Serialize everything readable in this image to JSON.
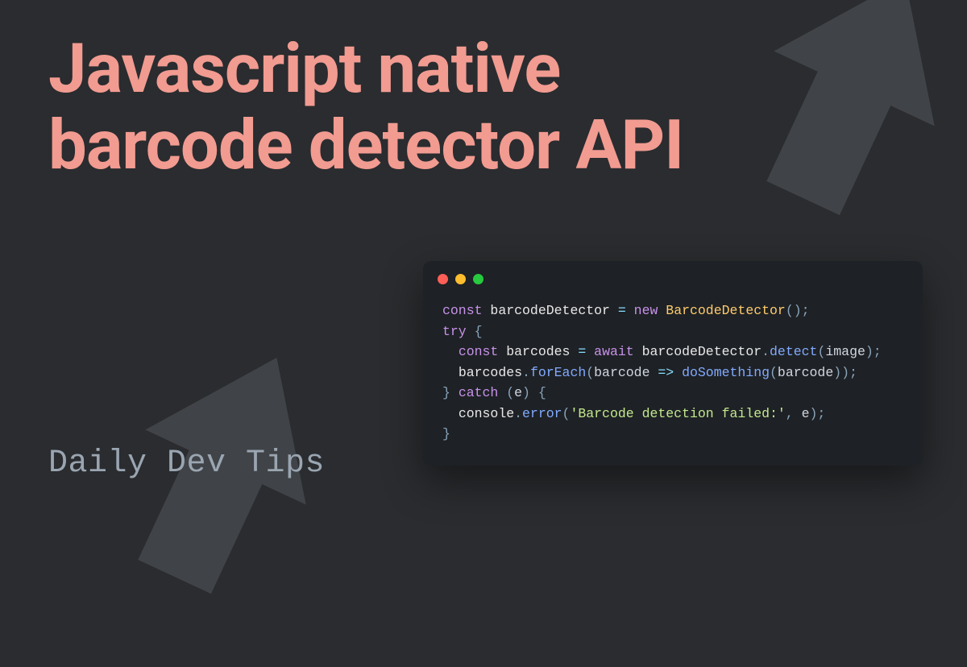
{
  "title_line1": "Javascript native",
  "title_line2": "barcode detector API",
  "footer": "Daily Dev Tips",
  "colors": {
    "background": "#2a2c2f",
    "title": "#f29b91",
    "footer": "#9aa5b1",
    "code_bg": "#1e2125",
    "arrow": "#404347"
  },
  "code": {
    "tokens": {
      "const": "const",
      "barcodeDetector": "barcodeDetector",
      "eq": "=",
      "new": "new",
      "BarcodeDetector": "BarcodeDetector",
      "lparen": "(",
      "rparen": ")",
      "semi": ";",
      "try": "try",
      "lbrace": "{",
      "rbrace": "}",
      "barcodes": "barcodes",
      "await": "await",
      "detect": "detect",
      "image": "image",
      "dot": ".",
      "forEach": "forEach",
      "barcode": "barcode",
      "arrow": "=>",
      "doSomething": "doSomething",
      "catch": "catch",
      "e": "e",
      "console": "console",
      "error": "error",
      "str": "'Barcode detection failed:'",
      "comma": ","
    }
  }
}
